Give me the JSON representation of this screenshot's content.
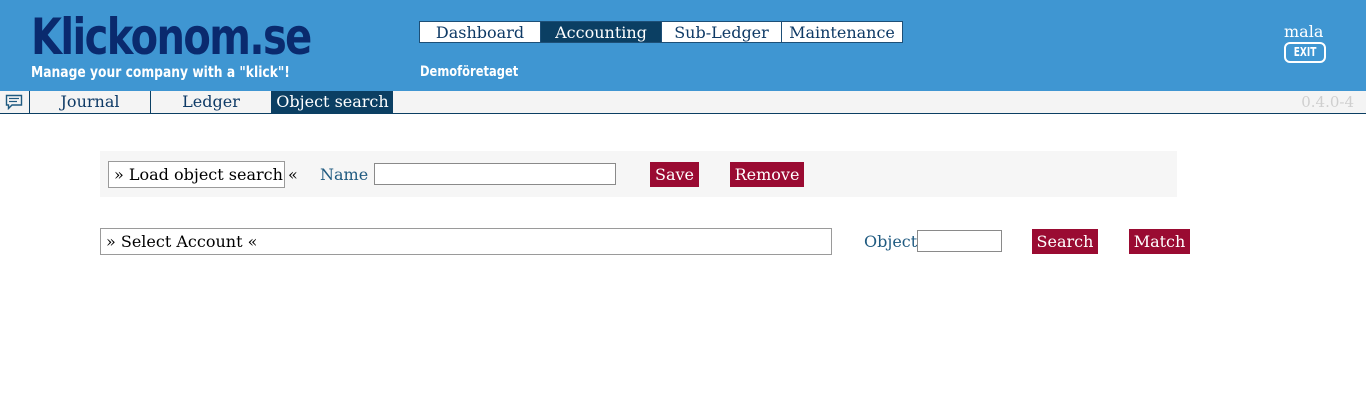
{
  "app": {
    "logo": "Klickonom.se",
    "tagline": "Manage your company with a \"klick\"!",
    "company": "Demoföretaget",
    "version": "0.4.0-4"
  },
  "main_tabs": [
    {
      "label": "Dashboard",
      "active": false
    },
    {
      "label": "Accounting",
      "active": true
    },
    {
      "label": "Sub-Ledger",
      "active": false
    },
    {
      "label": "Maintenance",
      "active": false
    }
  ],
  "user": {
    "name": "mala",
    "exit_label": "EXIT"
  },
  "sub_tabs": [
    {
      "label": "Journal",
      "active": false
    },
    {
      "label": "Ledger",
      "active": false
    },
    {
      "label": "Object search",
      "active": true
    }
  ],
  "object_search": {
    "load_label": "» Load object search «",
    "name_label": "Name",
    "name_value": "",
    "save_label": "Save",
    "remove_label": "Remove"
  },
  "search": {
    "account_select_label": "» Select Account «",
    "object_label": "Object",
    "object_value": "",
    "search_label": "Search",
    "match_label": "Match"
  },
  "colors": {
    "header_bg": "#3f96d2",
    "logo": "#0a2a6e",
    "active_tab": "#0b3f63",
    "button": "#9a0b32"
  }
}
